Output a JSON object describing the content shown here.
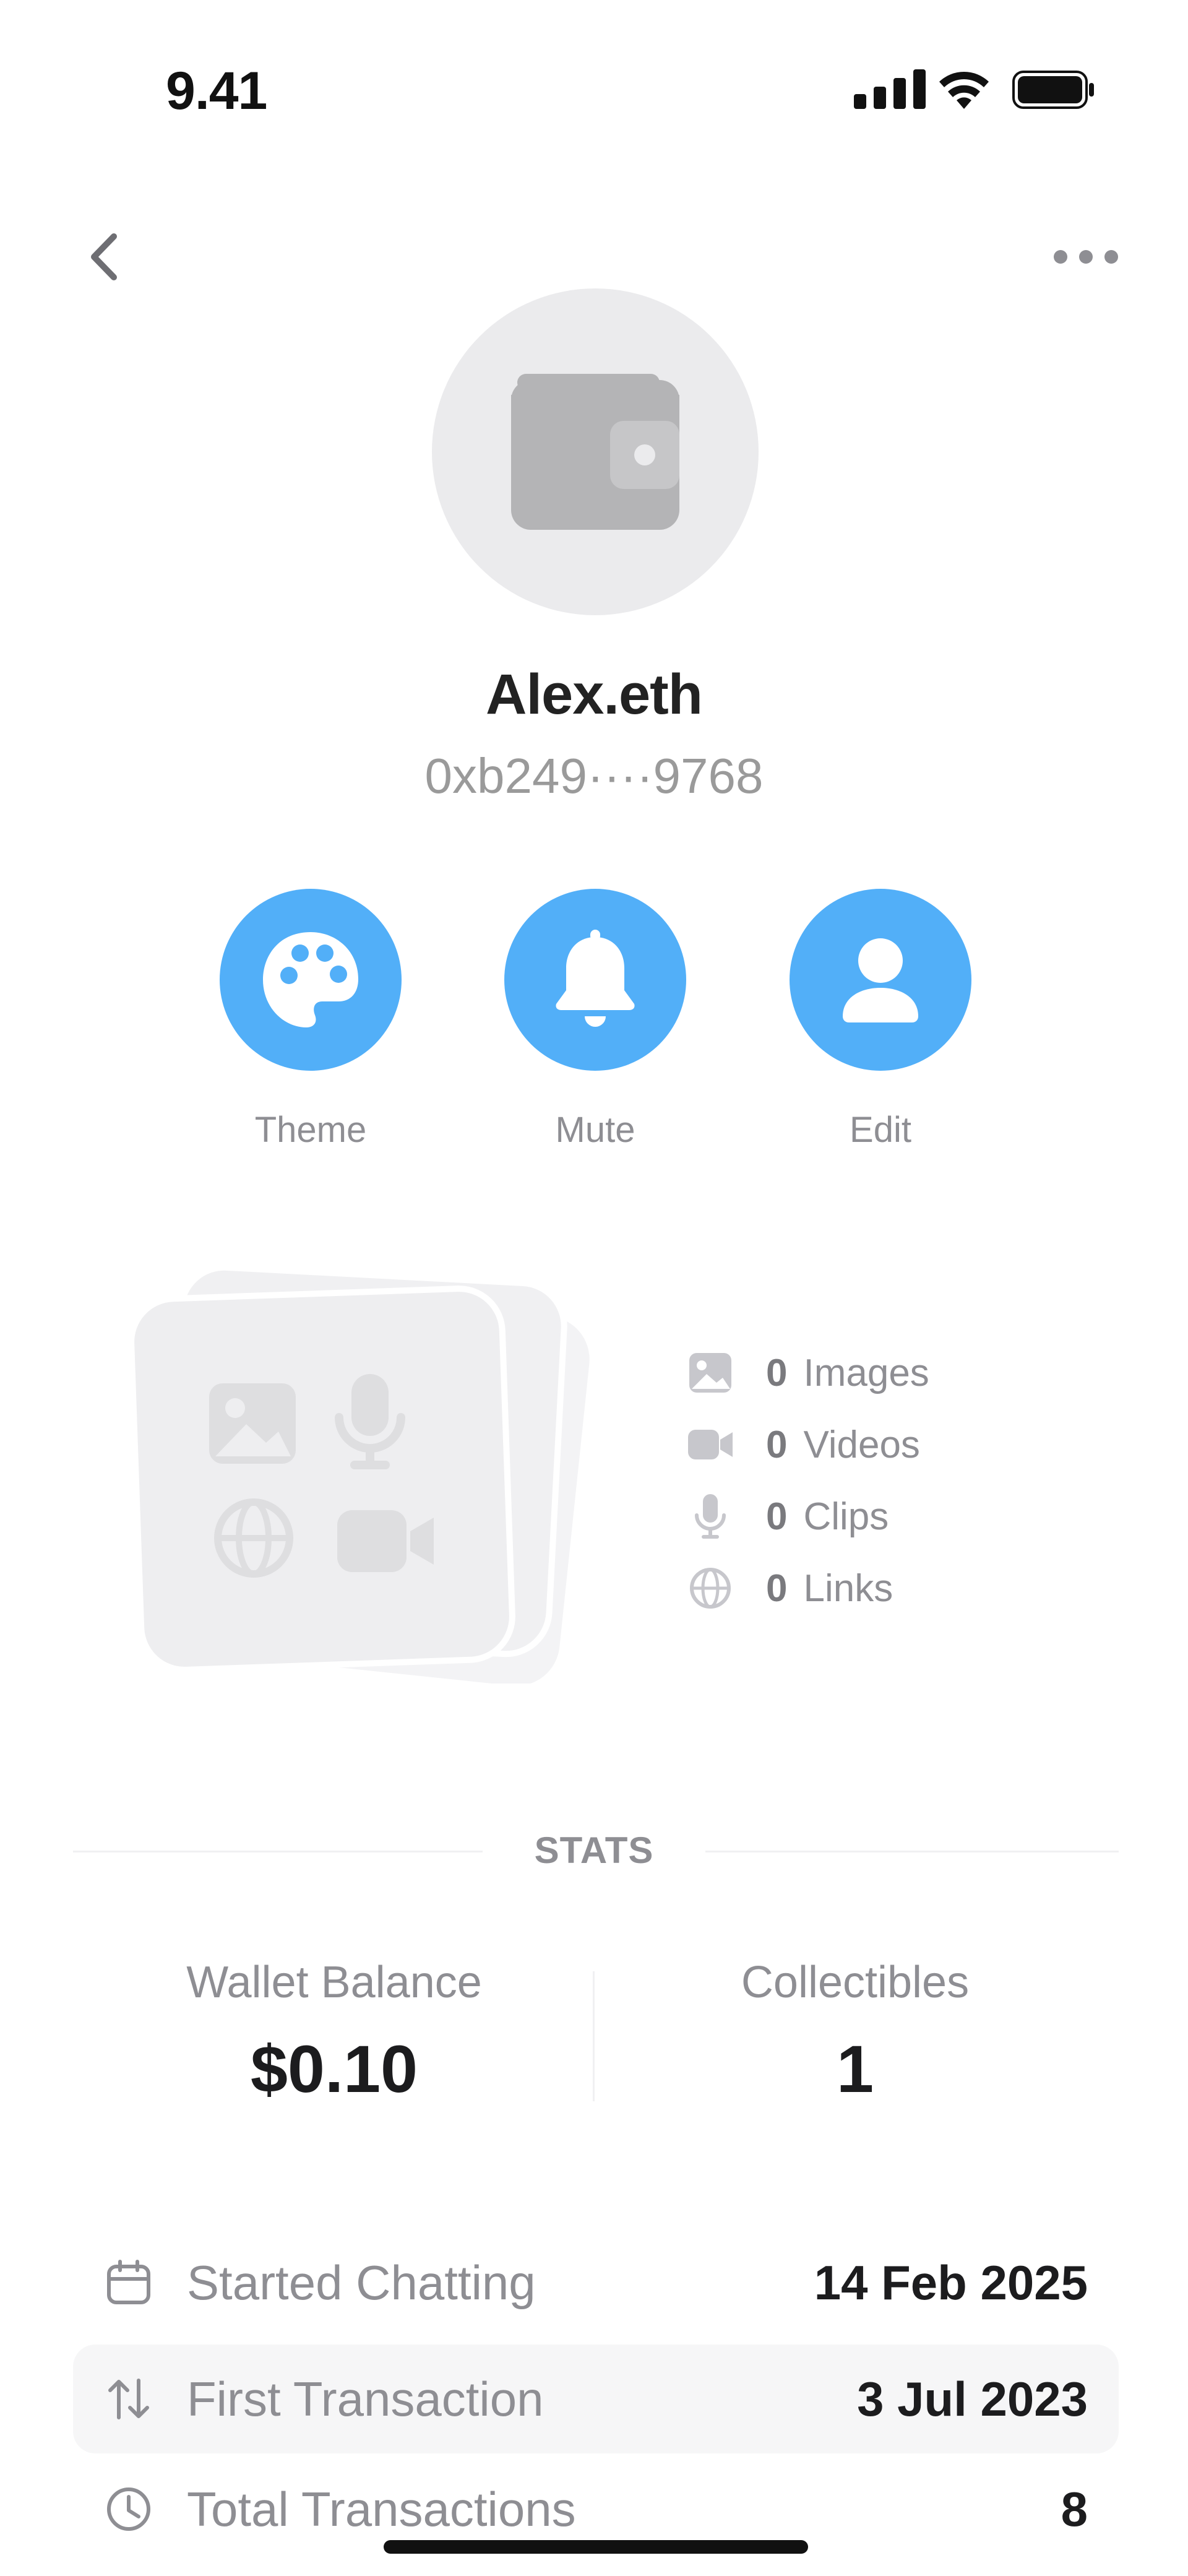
{
  "status_bar": {
    "time": "9.41",
    "icons": [
      "signal-icon",
      "wifi-icon",
      "battery-icon"
    ]
  },
  "nav": {
    "back_icon": "chevron-left-icon",
    "more_icon": "more-horizontal-icon"
  },
  "profile": {
    "avatar_icon": "wallet-icon",
    "name": "Alex.eth",
    "address": "0xb249····9768"
  },
  "actions": [
    {
      "label": "Theme",
      "icon": "palette-icon"
    },
    {
      "label": "Mute",
      "icon": "bell-icon"
    },
    {
      "label": "Edit",
      "icon": "person-icon"
    }
  ],
  "media": [
    {
      "count": "0",
      "label": "Images",
      "icon": "image-icon"
    },
    {
      "count": "0",
      "label": "Videos",
      "icon": "video-icon"
    },
    {
      "count": "0",
      "label": "Clips",
      "icon": "microphone-icon"
    },
    {
      "count": "0",
      "label": "Links",
      "icon": "globe-icon"
    }
  ],
  "stats": {
    "title": "STATS",
    "wallet_balance_label": "Wallet Balance",
    "wallet_balance_value": "$0.10",
    "collectibles_label": "Collectibles",
    "collectibles_value": "1"
  },
  "info_rows": [
    {
      "label": "Started Chatting",
      "value": "14 Feb 2025",
      "icon": "calendar-icon"
    },
    {
      "label": "First Transaction",
      "value": "3 Jul 2023",
      "icon": "transfer-arrows-icon"
    },
    {
      "label": "Total Transactions",
      "value": "8",
      "icon": "clock-icon"
    }
  ],
  "colors": {
    "accent": "#52aff8",
    "muted_text": "#8e8e93",
    "avatar_bg": "#ebebed",
    "row_highlight": "#f6f6f7"
  }
}
